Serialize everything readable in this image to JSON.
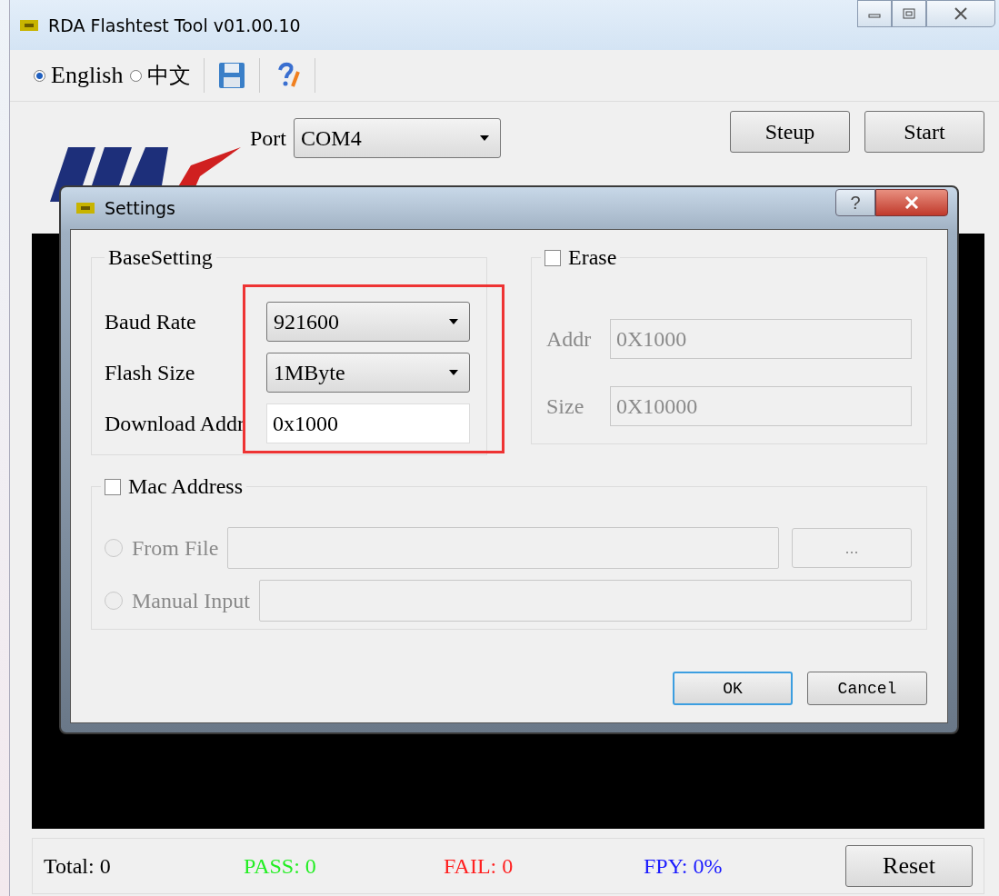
{
  "window": {
    "title": "RDA Flashtest Tool v01.00.10"
  },
  "languages": [
    {
      "label": "English",
      "selected": true
    },
    {
      "label": "中文",
      "selected": false
    }
  ],
  "port": {
    "label": "Port",
    "value": "COM4"
  },
  "buttons": [
    "Steup",
    "Start"
  ],
  "dialog": {
    "title": "Settings",
    "help": "?",
    "base": {
      "title": "BaseSetting",
      "fields": [
        {
          "kind": "dropdown",
          "label": "Baud Rate",
          "value": "921600"
        },
        {
          "kind": "dropdown",
          "label": "Flash Size",
          "value": "1MByte"
        },
        {
          "kind": "input",
          "label": "Download Addr",
          "value": "0x1000"
        }
      ]
    },
    "erase": {
      "label": "Erase",
      "checked": false,
      "disabled": true,
      "fields": [
        {
          "label": "Addr",
          "value": "0X1000"
        },
        {
          "label": "Size",
          "value": "0X10000"
        }
      ]
    },
    "mac": {
      "label": "Mac Address",
      "checked": false,
      "disabled": true,
      "options": [
        {
          "label": "From File",
          "selected": false,
          "browse": "..."
        },
        {
          "label": "Manual Input",
          "selected": false
        }
      ]
    },
    "buttons": [
      "OK",
      "Cancel"
    ]
  },
  "stats": [
    {
      "text": "Total: 0",
      "color": "#000000"
    },
    {
      "text": "PASS: 0",
      "color": "#22ee22"
    },
    {
      "text": "FAIL: 0",
      "color": "#ff2020"
    },
    {
      "text": "FPY: 0%",
      "color": "#1a1aff"
    }
  ],
  "reset": "Reset"
}
